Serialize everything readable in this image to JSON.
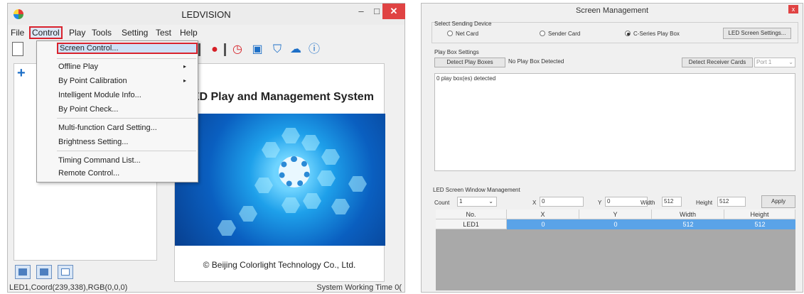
{
  "left_window": {
    "title": "LEDVISION",
    "controls": {
      "minimize": "–",
      "maximize": "□",
      "close": "✕"
    },
    "menubar": [
      "File",
      "Control",
      "Play",
      "Tools",
      "Setting",
      "Test",
      "Help"
    ],
    "control_menu": {
      "items": [
        {
          "label": "Screen Control...",
          "highlighted": true
        },
        {
          "label": "Offline Play",
          "submenu": true
        },
        {
          "label": "By Point Calibration",
          "submenu": true
        },
        {
          "label": "Intelligent Module Info..."
        },
        {
          "label": "By Point Check..."
        },
        {
          "label": "Multi-function Card Setting..."
        },
        {
          "label": "Brightness Setting..."
        },
        {
          "label": "Timing Command List..."
        },
        {
          "label": "Remote Control..."
        }
      ],
      "submenu_arrow": "▸"
    },
    "banner": {
      "title": "LED Play and Management System",
      "copyright": "© Beijing Colorlight Technology Co., Ltd."
    },
    "statusbar": {
      "left": "LED1,Coord(239,338),RGB(0,0,0)",
      "right": "System Working Time 0("
    }
  },
  "right_window": {
    "title": "Screen Management",
    "close": "x",
    "sending_device": {
      "label": "Select Sending Device",
      "options": [
        "Net Card",
        "Sender Card",
        "C-Series Play Box"
      ],
      "selected": "C-Series Play Box",
      "settings_button": "LED Screen Settings..."
    },
    "play_box": {
      "label": "Play Box Settings",
      "detect_button": "Detect Play Boxes",
      "status_value": "No Play Box Detected",
      "detect_receiver_button": "Detect Receiver Cards",
      "port_value": "Port 1",
      "log_text": "0 play box(es) detected"
    },
    "window_management": {
      "label": "LED Screen Window Management",
      "count_label": "Count",
      "count_value": "1",
      "x_label": "X",
      "x_value": "0",
      "y_label": "Y",
      "y_value": "0",
      "width_label": "Width",
      "width_value": "512",
      "height_label": "Height",
      "height_value": "512",
      "apply_button": "Apply",
      "columns": [
        "No.",
        "X",
        "Y",
        "Width",
        "Height"
      ],
      "rows": [
        [
          "LED1",
          "0",
          "0",
          "512",
          "512"
        ]
      ]
    }
  }
}
